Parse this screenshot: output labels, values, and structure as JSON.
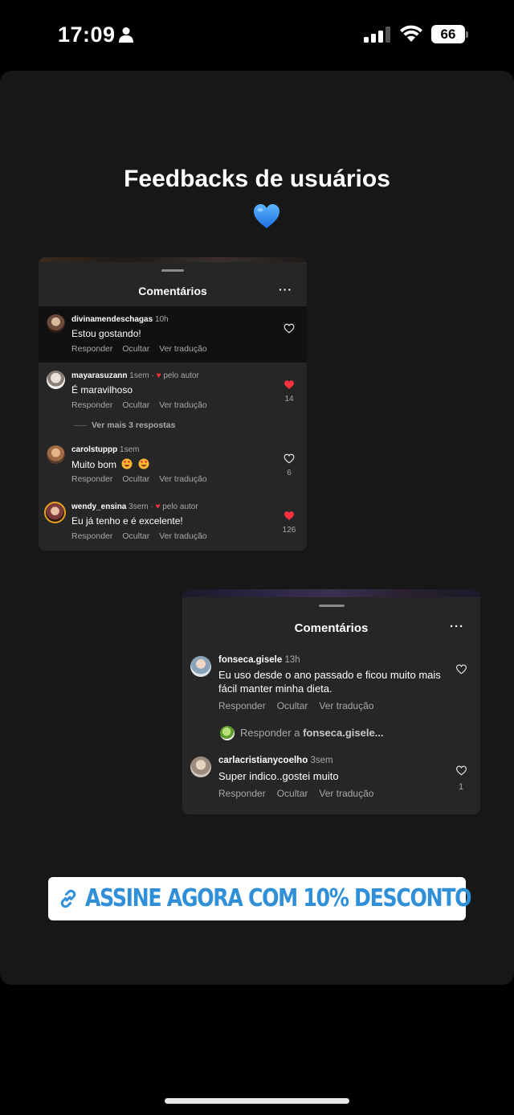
{
  "status_bar": {
    "time": "17:09",
    "battery": "66",
    "icons": [
      "person-icon",
      "cellular-signal-icon",
      "wifi-icon",
      "battery-icon"
    ]
  },
  "story": {
    "headline": "Feedbacks de usuários",
    "emoji": "blue-heart-icon"
  },
  "card1": {
    "title": "Comentários",
    "menu": "···",
    "comments": [
      {
        "username": "divinamendeschagas",
        "meta": "10h",
        "text": "Estou gostando!",
        "actions": [
          "Responder",
          "Ocultar",
          "Ver tradução"
        ],
        "liked": false,
        "likes": ""
      },
      {
        "username": "mayarasuzann",
        "meta": "1sem ·",
        "author_like": "pelo autor",
        "text": "É maravilhoso",
        "actions": [
          "Responder",
          "Ocultar",
          "Ver tradução"
        ],
        "liked": true,
        "likes": "14"
      },
      {
        "username": "carolstuppp",
        "meta": "1sem",
        "text": "Muito bom",
        "actions": [
          "Responder",
          "Ocultar",
          "Ver tradução"
        ],
        "liked": false,
        "likes": "6"
      },
      {
        "username": "wendy_ensina",
        "meta": "3sem ·",
        "author_like": "pelo autor",
        "text": "Eu já tenho e é excelente!",
        "actions": [
          "Responder",
          "Ocultar",
          "Ver tradução"
        ],
        "liked": true,
        "likes": "126"
      }
    ],
    "more_replies": "Ver mais 3 respostas"
  },
  "card2": {
    "title": "Comentários",
    "menu": "···",
    "comments": [
      {
        "username": "fonseca.gisele",
        "meta": "13h",
        "text": "Eu uso desde o ano passado e ficou muito mais fácil manter minha dieta.",
        "actions": [
          "Responder",
          "Ocultar",
          "Ver tradução"
        ],
        "liked": false,
        "likes": ""
      },
      {
        "username": "carlacristianycoelho",
        "meta": "3sem",
        "text": "Super indico..gostei muito",
        "actions": [
          "Responder",
          "Ocultar",
          "Ver tradução"
        ],
        "liked": false,
        "likes": "1"
      }
    ],
    "reply_prefix": "Responder a",
    "reply_user": "fonseca.gisele..."
  },
  "cta": {
    "label": "ASSINE AGORA COM 10% DESCONTO",
    "icon": "link-icon",
    "color": "#2f8fd8"
  },
  "colors": {
    "panel": "#171717",
    "card": "#262626",
    "like_red": "#ff3040"
  }
}
